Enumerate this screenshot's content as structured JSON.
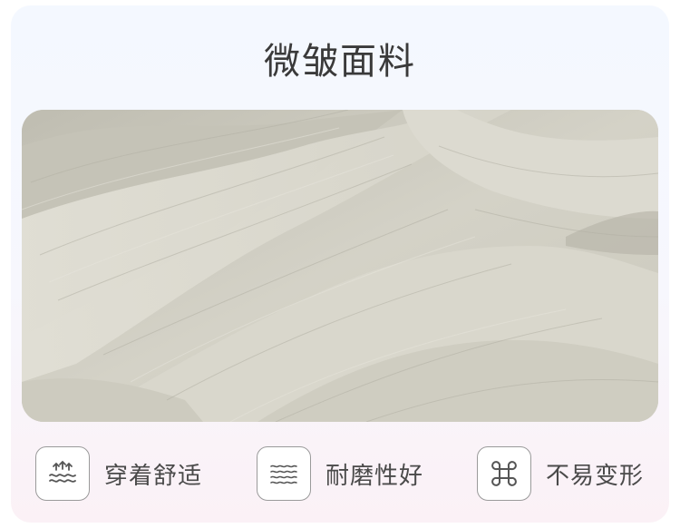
{
  "title": "微皱面料",
  "features": [
    {
      "icon": "wave-steam-icon",
      "label": "穿着舒适"
    },
    {
      "icon": "wavy-lines-icon",
      "label": "耐磨性好"
    },
    {
      "icon": "command-loop-icon",
      "label": "不易变形"
    }
  ]
}
